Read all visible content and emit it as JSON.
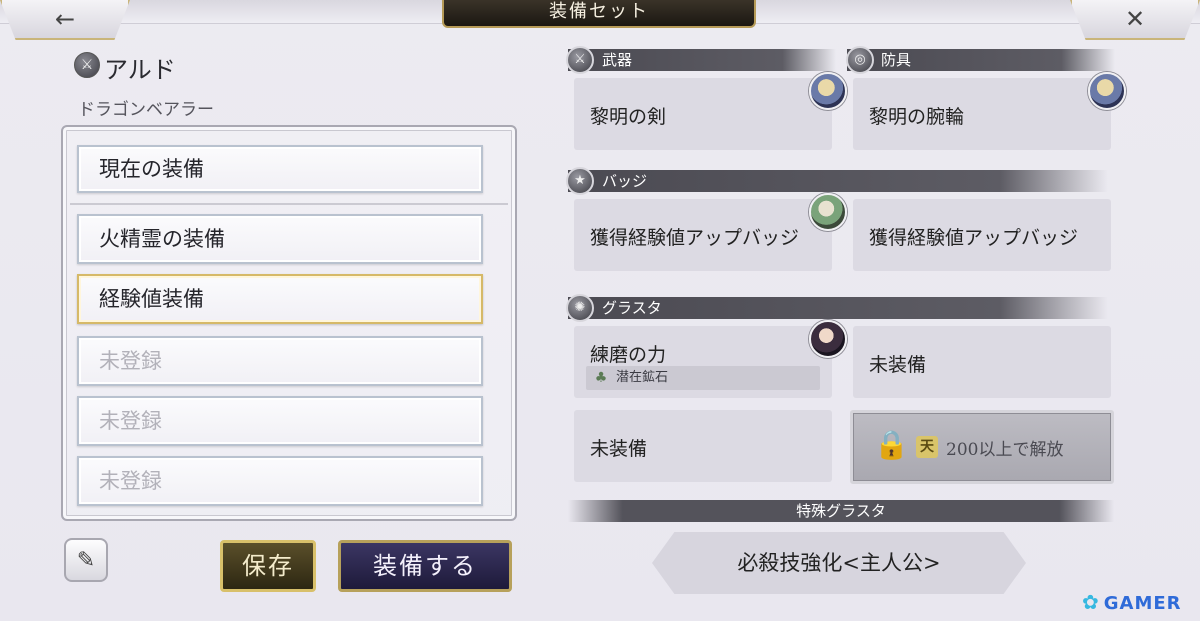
{
  "header": {
    "title": "装備セット",
    "back_icon": "←",
    "close_icon": "✕"
  },
  "character": {
    "icon": "⚔",
    "name": "アルド",
    "title": "ドラゴンベアラー"
  },
  "presets": {
    "current": "現在の装備",
    "items": [
      {
        "label": "火精霊の装備",
        "state": "registered"
      },
      {
        "label": "経験値装備",
        "state": "selected"
      },
      {
        "label": "未登録",
        "state": "empty"
      },
      {
        "label": "未登録",
        "state": "empty"
      },
      {
        "label": "未登録",
        "state": "empty"
      }
    ]
  },
  "buttons": {
    "edit_icon": "✎",
    "save": "保存",
    "equip": "装備する"
  },
  "weapon": {
    "header": "武器",
    "icon": "⚔",
    "item": "黎明の剣"
  },
  "armor": {
    "header": "防具",
    "icon": "◎",
    "item": "黎明の腕輪"
  },
  "badge": {
    "header": "バッジ",
    "icon": "★",
    "slots": [
      "獲得経験値アップバッジ",
      "獲得経験値アップバッジ"
    ]
  },
  "grasta": {
    "header": "グラスタ",
    "icon": "✺",
    "slot1": "練磨の力",
    "slot1_tag": "潜在鉱石",
    "slot1_tag_icon": "♣",
    "slot2": "未装備",
    "slot3": "未装備",
    "locked_badge": "天",
    "locked_text": "200以上で解放",
    "lock_icon": "🔒"
  },
  "special_grasta": {
    "header": "特殊グラスタ",
    "slot": "必殺技強化<主人公>"
  },
  "watermark": {
    "mark": "✿",
    "text": "GAMER"
  }
}
